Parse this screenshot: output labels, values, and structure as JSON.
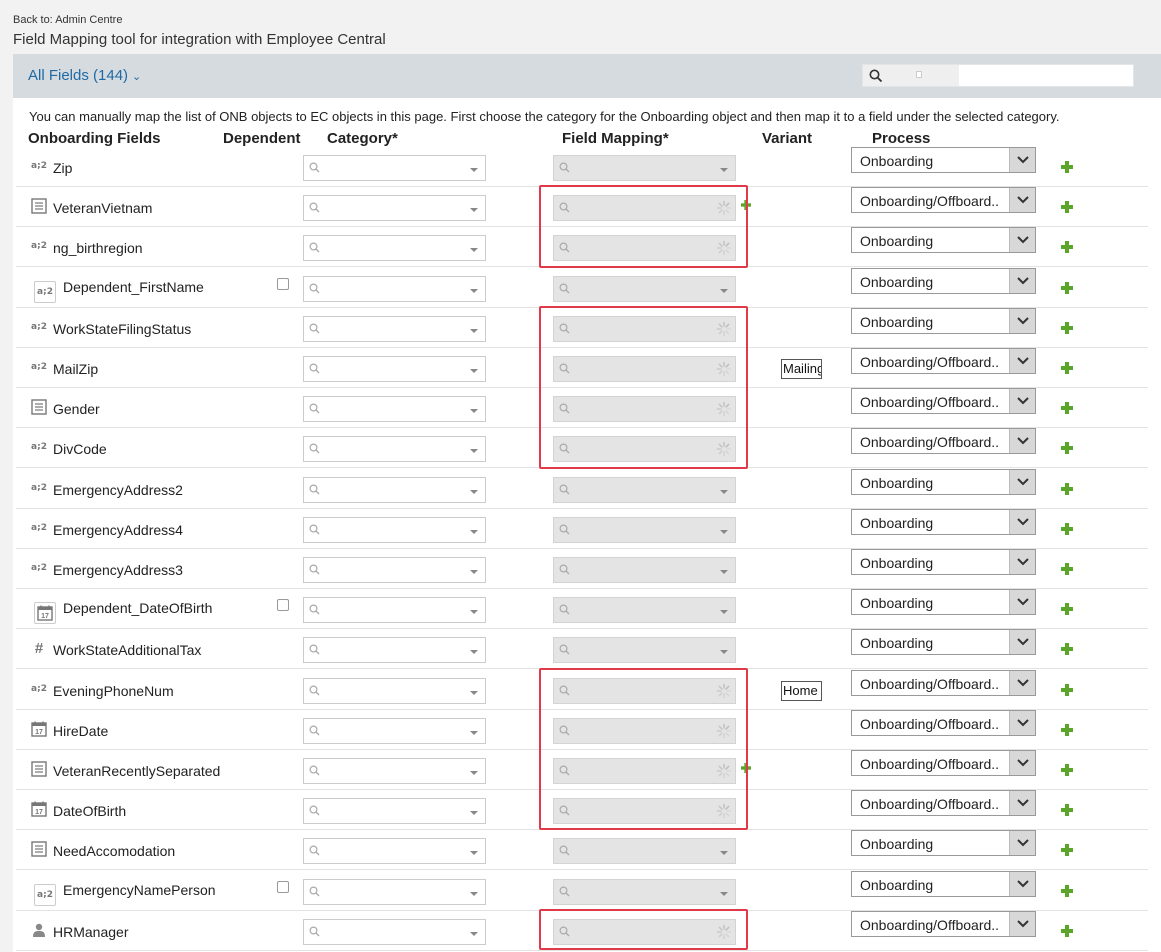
{
  "breadcrumb": "Back to: Admin Centre",
  "page_title": "Field Mapping tool for integration with Employee Central",
  "header": {
    "all_fields_label": "All Fields (144)",
    "search_value": ""
  },
  "instructions": "You can manually map the list of ONB objects to EC objects in this page. First choose the category for the Onboarding object and then map it to a field under the selected category.",
  "columns": {
    "onboarding_fields": "Onboarding Fields",
    "dependent": "Dependent",
    "category": "Category*",
    "field_mapping": "Field Mapping*",
    "variant": "Variant",
    "process": "Process"
  },
  "colors": {
    "accent": "#1f6aa5",
    "highlight": "#e0394a",
    "plus_green": "#5aa52a"
  },
  "rows": [
    {
      "label": "Zip",
      "icon": "text-icon",
      "dependent": false,
      "loading": false,
      "variant": "",
      "process": "Onboarding",
      "inline_plus": false
    },
    {
      "label": "VeteranVietnam",
      "icon": "list-icon",
      "dependent": false,
      "loading": true,
      "variant": "",
      "process": "Onboarding/Offboard..",
      "inline_plus": true
    },
    {
      "label": "ng_birthregion",
      "icon": "text-icon",
      "dependent": false,
      "loading": true,
      "variant": "",
      "process": "Onboarding",
      "inline_plus": false
    },
    {
      "label": "Dependent_FirstName",
      "icon": "text-icon-boxed",
      "dependent": true,
      "loading": false,
      "variant": "",
      "process": "Onboarding",
      "inline_plus": false
    },
    {
      "label": "WorkStateFilingStatus",
      "icon": "text-icon",
      "dependent": false,
      "loading": true,
      "variant": "",
      "process": "Onboarding",
      "inline_plus": false
    },
    {
      "label": "MailZip",
      "icon": "text-icon",
      "dependent": false,
      "loading": true,
      "variant": "Mailing",
      "process": "Onboarding/Offboard..",
      "inline_plus": false
    },
    {
      "label": "Gender",
      "icon": "list-icon",
      "dependent": false,
      "loading": true,
      "variant": "",
      "process": "Onboarding/Offboard..",
      "inline_plus": false
    },
    {
      "label": "DivCode",
      "icon": "text-icon",
      "dependent": false,
      "loading": true,
      "variant": "",
      "process": "Onboarding/Offboard..",
      "inline_plus": false
    },
    {
      "label": "EmergencyAddress2",
      "icon": "text-icon",
      "dependent": false,
      "loading": false,
      "variant": "",
      "process": "Onboarding",
      "inline_plus": false
    },
    {
      "label": "EmergencyAddress4",
      "icon": "text-icon",
      "dependent": false,
      "loading": false,
      "variant": "",
      "process": "Onboarding",
      "inline_plus": false
    },
    {
      "label": "EmergencyAddress3",
      "icon": "text-icon",
      "dependent": false,
      "loading": false,
      "variant": "",
      "process": "Onboarding",
      "inline_plus": false
    },
    {
      "label": "Dependent_DateOfBirth",
      "icon": "calendar-icon-boxed",
      "dependent": true,
      "loading": false,
      "variant": "",
      "process": "Onboarding",
      "inline_plus": false
    },
    {
      "label": "WorkStateAdditionalTax",
      "icon": "number-icon",
      "dependent": false,
      "loading": false,
      "variant": "",
      "process": "Onboarding",
      "inline_plus": false
    },
    {
      "label": "EveningPhoneNum",
      "icon": "text-icon",
      "dependent": false,
      "loading": true,
      "variant": "Home",
      "process": "Onboarding/Offboard..",
      "inline_plus": false
    },
    {
      "label": "HireDate",
      "icon": "calendar-icon",
      "dependent": false,
      "loading": true,
      "variant": "",
      "process": "Onboarding/Offboard..",
      "inline_plus": false
    },
    {
      "label": "VeteranRecentlySeparated",
      "icon": "list-icon",
      "dependent": false,
      "loading": true,
      "variant": "",
      "process": "Onboarding/Offboard..",
      "inline_plus": true
    },
    {
      "label": "DateOfBirth",
      "icon": "calendar-icon",
      "dependent": false,
      "loading": true,
      "variant": "",
      "process": "Onboarding/Offboard..",
      "inline_plus": false
    },
    {
      "label": "NeedAccomodation",
      "icon": "list-icon",
      "dependent": false,
      "loading": false,
      "variant": "",
      "process": "Onboarding",
      "inline_plus": false
    },
    {
      "label": "EmergencyNamePerson",
      "icon": "text-icon-boxed",
      "dependent": true,
      "loading": false,
      "variant": "",
      "process": "Onboarding",
      "inline_plus": false
    },
    {
      "label": "HRManager",
      "icon": "person-icon",
      "dependent": false,
      "loading": true,
      "variant": "",
      "process": "Onboarding/Offboard..",
      "inline_plus": false
    }
  ]
}
